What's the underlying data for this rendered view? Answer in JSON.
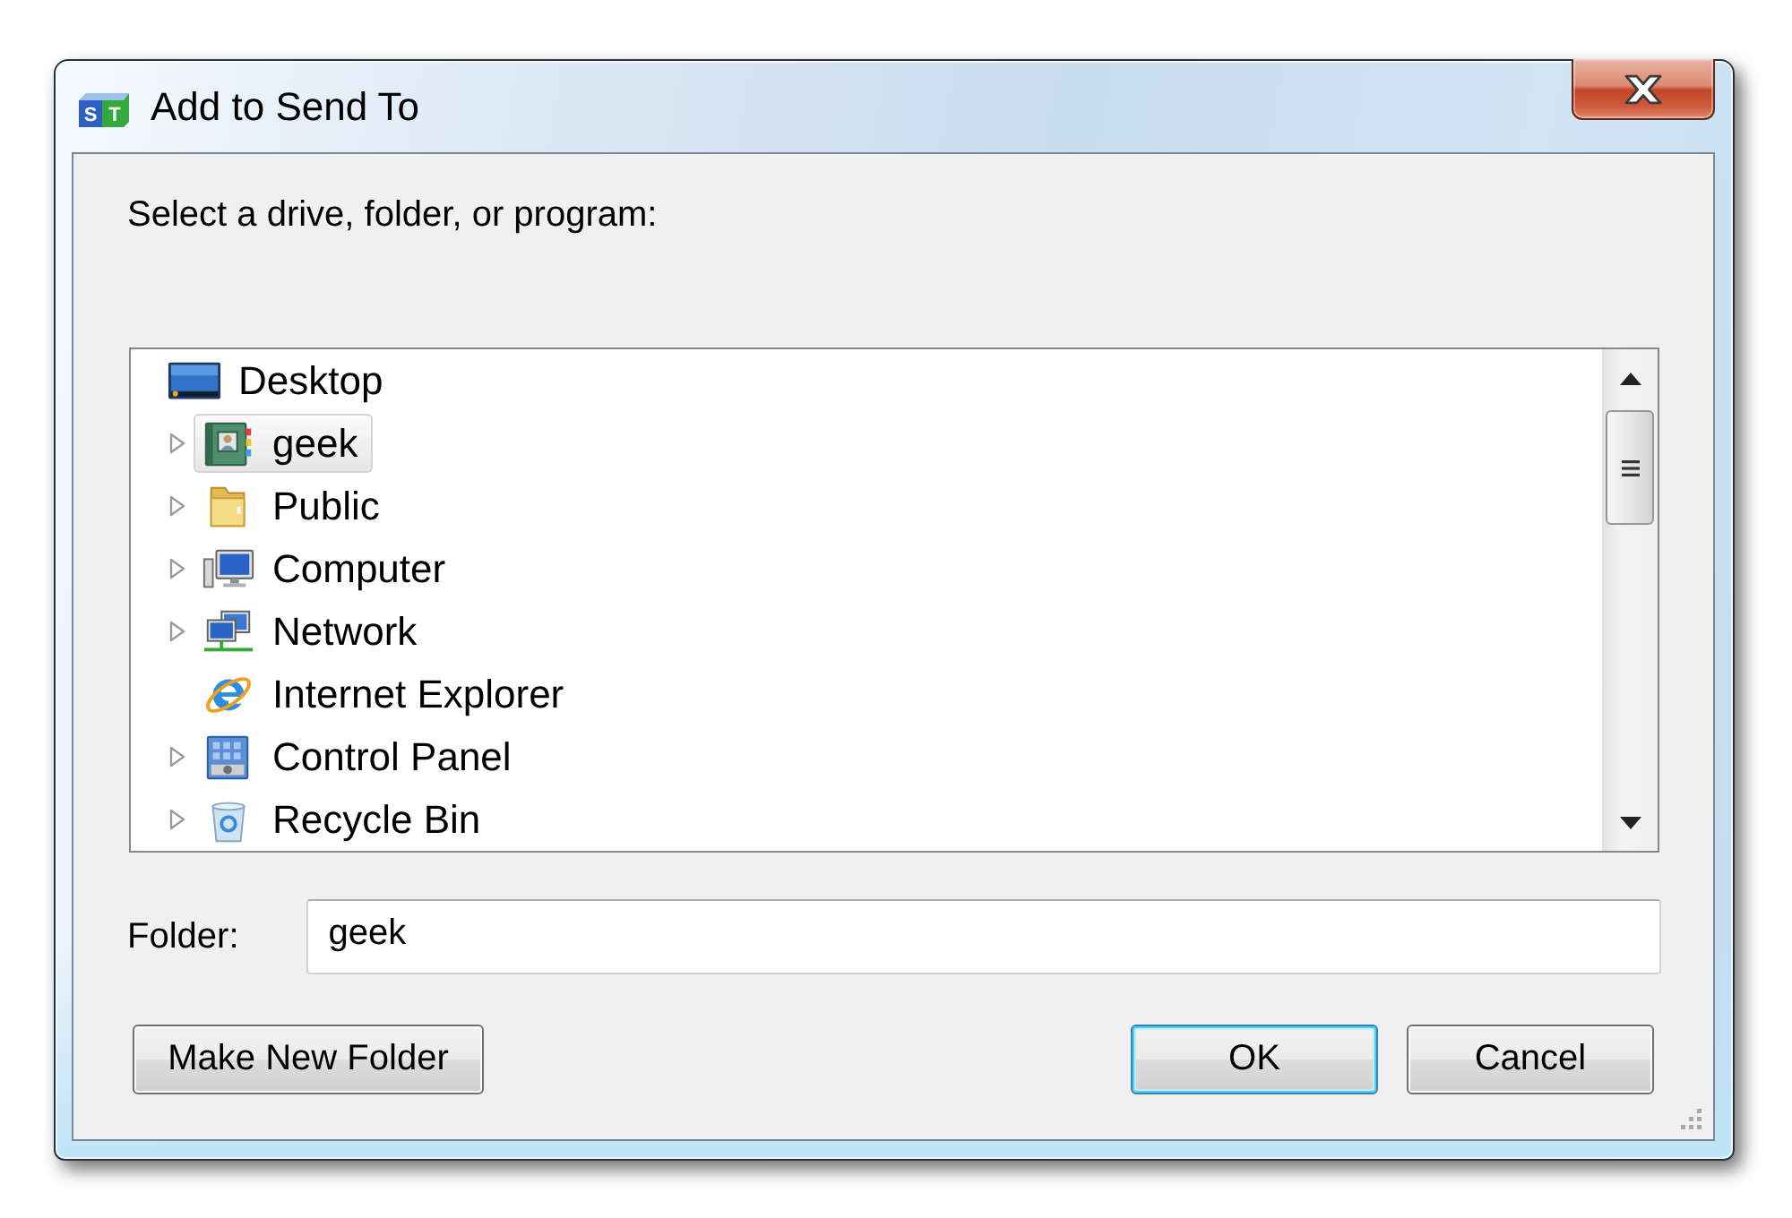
{
  "window": {
    "title": "Add to Send To",
    "icon_letters": [
      "S",
      "T"
    ]
  },
  "prompt": "Select a drive, folder, or program:",
  "tree": {
    "items": [
      {
        "label": "Desktop",
        "selected": false,
        "children": [
          {
            "label": "geek",
            "selected": true,
            "has_subitems": true
          },
          {
            "label": "Public",
            "selected": false,
            "has_subitems": true
          },
          {
            "label": "Computer",
            "selected": false,
            "has_subitems": true
          },
          {
            "label": "Network",
            "selected": false,
            "has_subitems": true
          },
          {
            "label": "Internet Explorer",
            "selected": false,
            "has_subitems": false
          },
          {
            "label": "Control Panel",
            "selected": false,
            "has_subitems": true
          },
          {
            "label": "Recycle Bin",
            "selected": false,
            "has_subitems": true
          }
        ]
      }
    ]
  },
  "folder": {
    "label": "Folder:",
    "value": "geek"
  },
  "buttons_left": [
    {
      "label": "Make New Folder",
      "default": false
    }
  ],
  "buttons_right": [
    {
      "label": "OK",
      "default": true
    },
    {
      "label": "Cancel",
      "default": false
    }
  ]
}
